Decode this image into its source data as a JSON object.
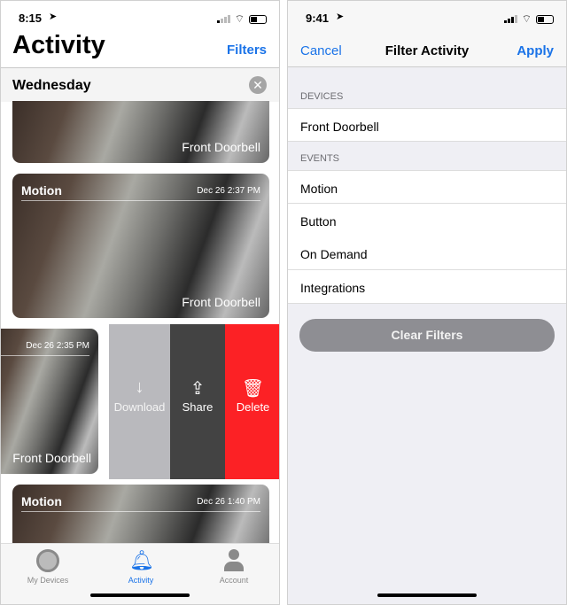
{
  "left": {
    "status": {
      "time": "8:15"
    },
    "title": "Activity",
    "filters_label": "Filters",
    "section": "Wednesday",
    "cards": [
      {
        "device": "Front Doorbell"
      },
      {
        "type": "Motion",
        "date": "Dec 26  2:37 PM",
        "device": "Front Doorbell"
      },
      {
        "date": "Dec 26  2:35 PM",
        "device": "Front Doorbell"
      },
      {
        "type": "Motion",
        "date": "Dec 26  1:40 PM"
      }
    ],
    "actions": {
      "download": "Download",
      "share": "Share",
      "delete": "Delete"
    },
    "colors": {
      "accent": "#1a73e8",
      "delete": "#fc2125",
      "share": "#434343",
      "download": "#b9b9bd"
    },
    "tabs": [
      {
        "label": "My Devices"
      },
      {
        "label": "Activity",
        "active": true
      },
      {
        "label": "Account"
      }
    ]
  },
  "right": {
    "status": {
      "time": "9:41"
    },
    "nav": {
      "cancel": "Cancel",
      "title": "Filter Activity",
      "apply": "Apply"
    },
    "devices_header": "DEVICES",
    "devices": [
      "Front Doorbell"
    ],
    "events_header": "EVENTS",
    "events": [
      "Motion",
      "Button",
      "On Demand",
      "Integrations"
    ],
    "clear_label": "Clear Filters"
  }
}
